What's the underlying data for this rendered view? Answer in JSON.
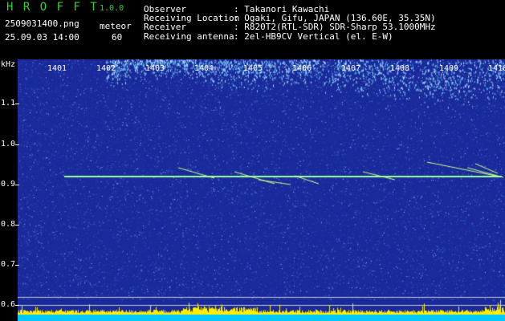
{
  "header": {
    "app_name": "H R O F F T",
    "version": "1.0.0",
    "filename": "2509031400.png",
    "datetime": "25.09.03 14:00",
    "meteor_label": "meteor",
    "meteor_count": "60",
    "fields": [
      {
        "label": "Observer",
        "value": ": Takanori Kawachi"
      },
      {
        "label": "Receiving Location",
        "value": ": Ogaki, Gifu, JAPAN (136.60E, 35.35N)"
      },
      {
        "label": "Receiver",
        "value": ": R820T2(RTL-SDR) SDR-Sharp 53.1000MHz"
      },
      {
        "label": "Receiving antenna",
        "value": ": 2el-HB9CV Vertical (el. E-W)"
      }
    ]
  },
  "spectrogram": {
    "y_unit": "kHz",
    "y_ticks": [
      "1.1",
      "1.0",
      "0.9",
      "0.8",
      "0.7",
      "0.6"
    ],
    "x_ticks": [
      "1401",
      "1402",
      "1403",
      "1404",
      "1405",
      "1406",
      "1407",
      "1408",
      "1409",
      "1410"
    ],
    "colors": {
      "background": "#1a2a9a",
      "noise": "#4f7bd8",
      "echo": "#c8ff80",
      "carrier": "#9cff9c",
      "level": "#ffee00",
      "baseline": "#00c8ff"
    }
  }
}
